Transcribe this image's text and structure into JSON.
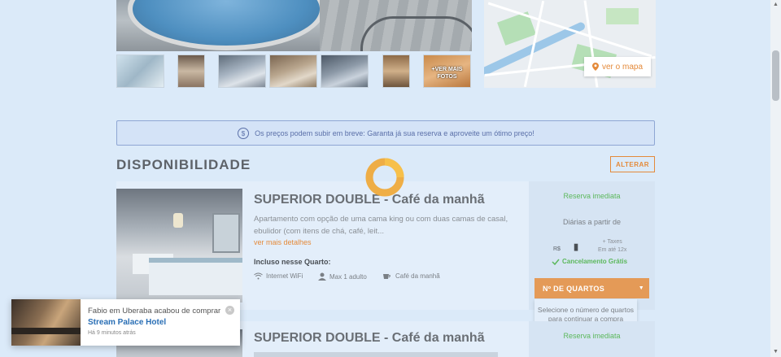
{
  "gallery": {
    "more_photos_label": "+VER MAIS FOTOS",
    "map_button_label": "ver o mapa"
  },
  "notice": {
    "text": "Os preços podem subir em breve: Garanta já sua reserva e aproveite um ótimo preço!"
  },
  "availability": {
    "title": "DISPONIBILIDADE",
    "change_button": "ALTERAR"
  },
  "rooms": [
    {
      "name": "SUPERIOR DOUBLE - Café da manhã",
      "description": "Apartamento com opção de uma cama king ou com duas camas de casal, ebulidor (com itens de chá, café, leit...",
      "more_link": "ver mais detalhes",
      "included_title": "Incluso nesse Quarto:",
      "amenities": [
        "Internet WiFi",
        "Max 1 adulto",
        "Café da manhã"
      ],
      "reserve_label": "Reserva imediata",
      "daily_label": "Diárias a partir de",
      "currency": "R$",
      "price": "",
      "taxes": "+ Taxes",
      "installments": "Em até 12x",
      "cancellation": "Cancelamento Grátis",
      "rooms_select_label": "Nº DE QUARTOS",
      "rooms_hint": "Selecione o número de quartos para continuar a compra"
    },
    {
      "name": "SUPERIOR DOUBLE - Café da manhã",
      "reserve_label": "Reserva imediata"
    }
  ],
  "toast": {
    "message": "Fabio em Uberaba acabou de comprar",
    "hotel": "Stream Palace Hotel",
    "time": "Há 9 minutos atrás"
  },
  "colors": {
    "accent": "#e48a3a",
    "success": "#5cb85c",
    "background": "#dbeaf9"
  }
}
